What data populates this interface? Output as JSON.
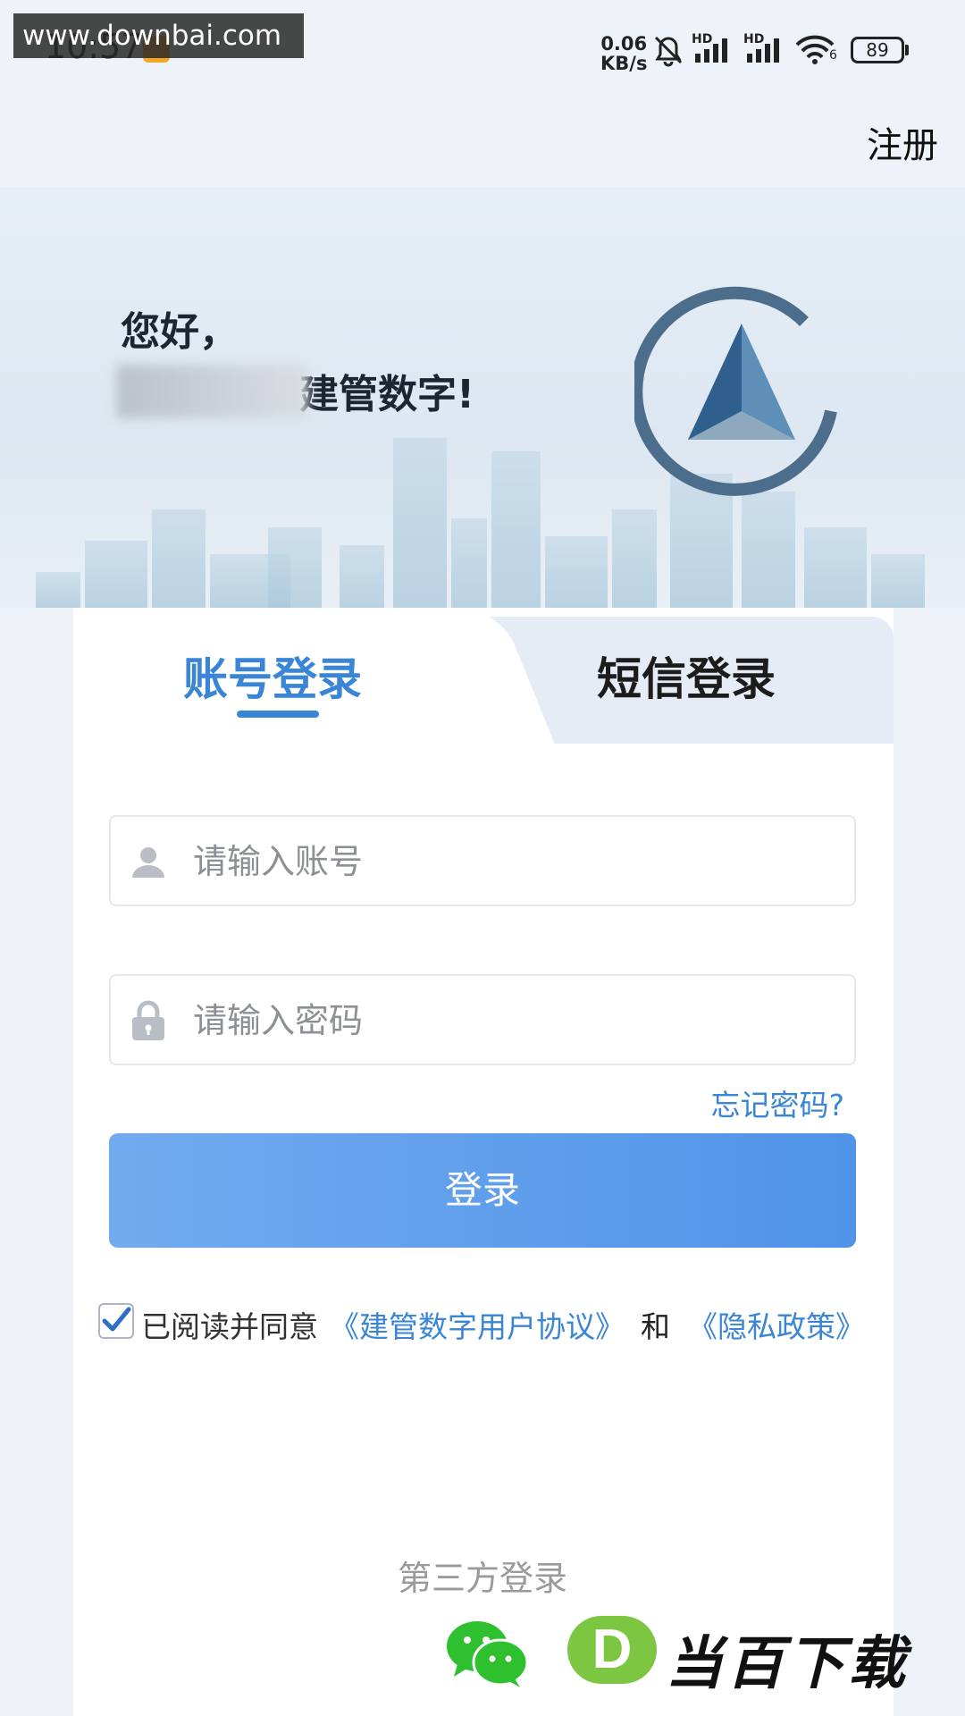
{
  "status_bar": {
    "time": "10:57",
    "watermark": "www.downbai.com",
    "net_speed_value": "0.06",
    "net_speed_unit": "KB/s",
    "signal_label_1": "HD",
    "signal_label_2": "HD",
    "wifi_label": "6",
    "battery": "89"
  },
  "header": {
    "register_label": "注册"
  },
  "hero": {
    "greeting_line1": "您好，",
    "greeting_line2": "建管数字!"
  },
  "tabs": [
    {
      "label": "账号登录",
      "active": true
    },
    {
      "label": "短信登录",
      "active": false
    }
  ],
  "form": {
    "account_placeholder": "请输入账号",
    "account_value": "",
    "password_placeholder": "请输入密码",
    "password_value": "",
    "forgot_label": "忘记密码?",
    "login_label": "登录"
  },
  "agreement": {
    "checked": true,
    "text": "已阅读并同意",
    "link1": "《建管数字用户协议》",
    "and": "和",
    "link2": "《隐私政策》"
  },
  "third_party": {
    "title": "第三方登录",
    "icon": "wechat-icon"
  },
  "badge": {
    "letter": "D",
    "text": "当百下载"
  },
  "colors": {
    "accent": "#3a85d6",
    "button_start": "#72aaef",
    "button_end": "#4f94e8",
    "wechat": "#2ec02e",
    "badge_green": "#7cc642"
  }
}
